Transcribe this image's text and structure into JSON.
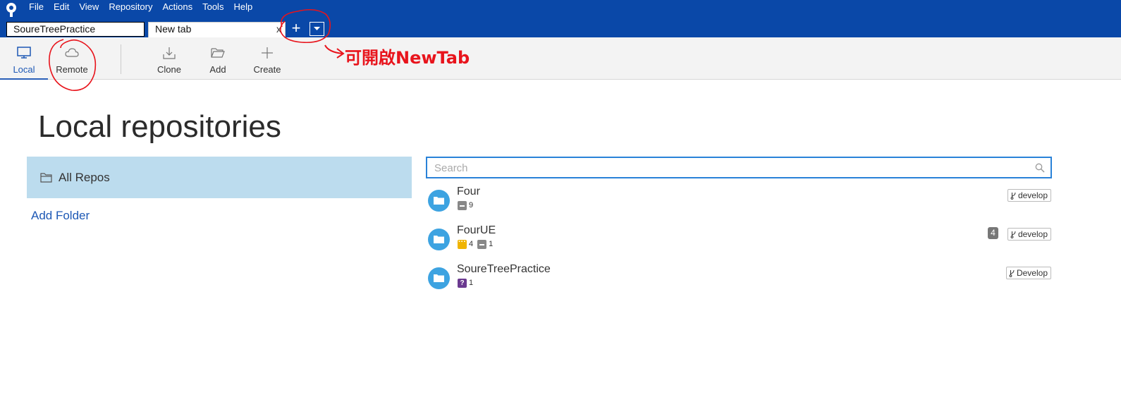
{
  "menu": [
    "File",
    "Edit",
    "View",
    "Repository",
    "Actions",
    "Tools",
    "Help"
  ],
  "tabs": {
    "items": [
      {
        "label": "SoureTreePractice"
      },
      {
        "label": "New tab",
        "close": "x"
      }
    ],
    "add_label": "+"
  },
  "toolbar": {
    "local": "Local",
    "remote": "Remote",
    "clone": "Clone",
    "add": "Add",
    "create": "Create"
  },
  "annotation": {
    "text": "可開啟NewTab",
    "color": "#e8141c"
  },
  "main": {
    "title": "Local repositories",
    "folders": {
      "all_repos": "All Repos",
      "add_folder": "Add Folder"
    },
    "search": {
      "placeholder": "Search",
      "value": ""
    },
    "repos": [
      {
        "name": "Four",
        "stats": [
          {
            "type": "removed",
            "count": "9"
          }
        ],
        "branch": "develop",
        "ahead": ""
      },
      {
        "name": "FourUE",
        "stats": [
          {
            "type": "modified",
            "count": "4"
          },
          {
            "type": "removed",
            "count": "1"
          }
        ],
        "branch": "develop",
        "ahead": "4"
      },
      {
        "name": "SoureTreePractice",
        "stats": [
          {
            "type": "untracked",
            "count": "1"
          }
        ],
        "branch": "Develop",
        "ahead": ""
      }
    ]
  },
  "colors": {
    "titlebar": "#0a48a8",
    "accent": "#1d58b5",
    "selected_folder": "#bcdcee",
    "repo_avatar": "#3da3e1"
  }
}
